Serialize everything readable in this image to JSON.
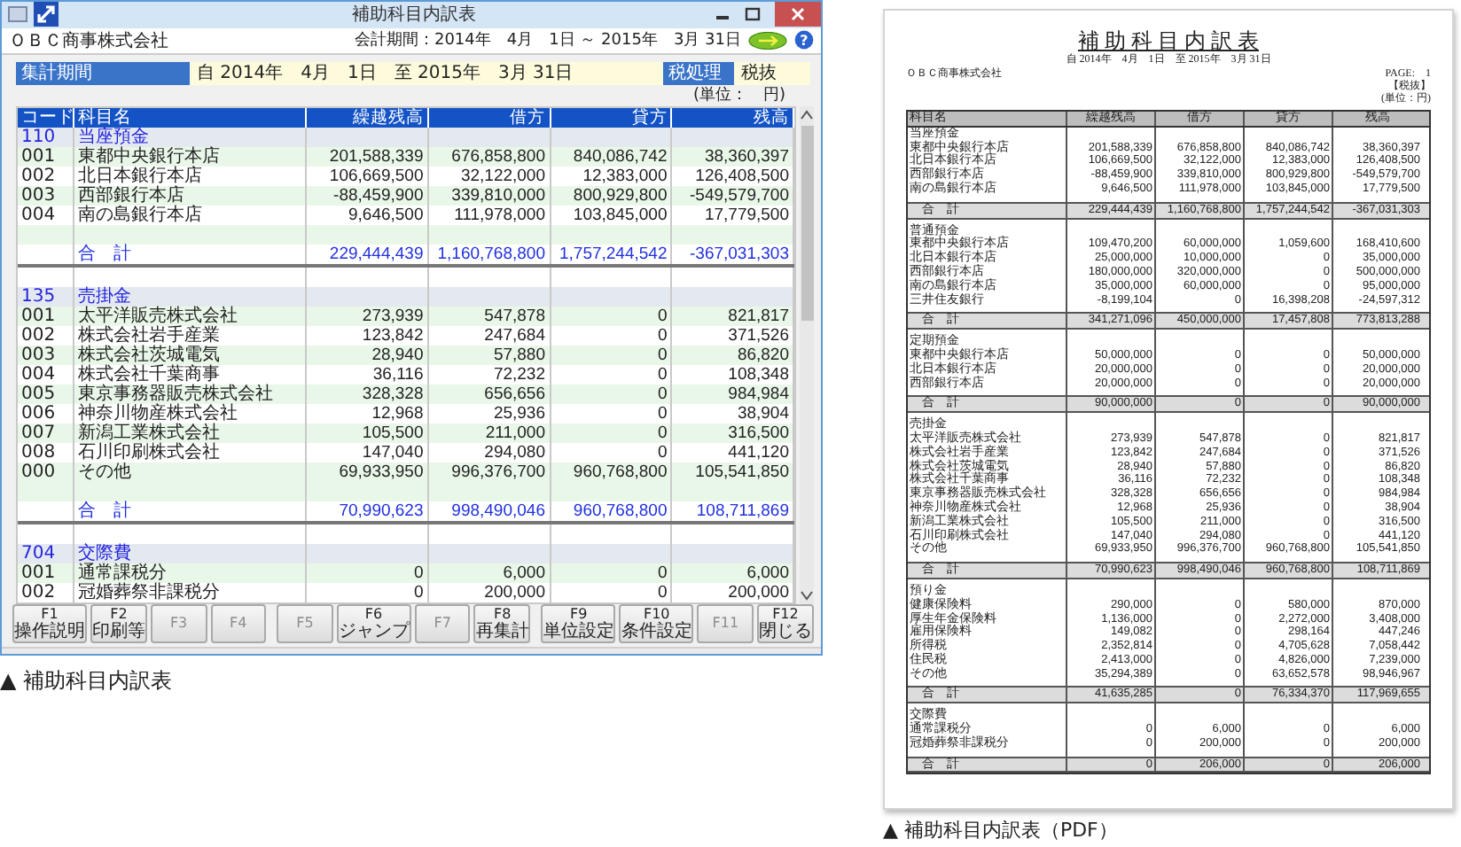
{
  "window": {
    "title": "補助科目内訳表",
    "company": "ＯＢＣ商事株式会社",
    "period": "会計期間：2014年　4月　1日 ～ 2015年　3月 31日",
    "help": "?"
  },
  "filter": {
    "period_label": "集計期間",
    "period_value": "自 2014年　4月　1日　至 2015年　3月 31日",
    "tax_label": "税処理",
    "tax_value": "税抜",
    "unit": "(単位：　円)"
  },
  "table": {
    "columns": [
      "コード",
      "科目名",
      "繰越残高",
      "借方",
      "貸方",
      "残高"
    ],
    "sections": [
      {
        "code": "110",
        "name": "当座預金",
        "rows": [
          {
            "code": "001",
            "name": "東都中央銀行本店",
            "values": [
              "201,588,339",
              "676,858,800",
              "840,086,742",
              "38,360,397"
            ]
          },
          {
            "code": "002",
            "name": "北日本銀行本店",
            "values": [
              "106,669,500",
              "32,122,000",
              "12,383,000",
              "126,408,500"
            ]
          },
          {
            "code": "003",
            "name": "西部銀行本店",
            "values": [
              "-88,459,900",
              "339,810,000",
              "800,929,800",
              "-549,579,700"
            ]
          },
          {
            "code": "004",
            "name": "南の島銀行本店",
            "values": [
              "9,646,500",
              "111,978,000",
              "103,845,000",
              "17,779,500"
            ]
          }
        ],
        "total": {
          "label": "合　計",
          "values": [
            "229,444,439",
            "1,160,768,800",
            "1,757,244,542",
            "-367,031,303"
          ]
        }
      },
      {
        "code": "135",
        "name": "売掛金",
        "rows": [
          {
            "code": "001",
            "name": "太平洋販売株式会社",
            "values": [
              "273,939",
              "547,878",
              "0",
              "821,817"
            ]
          },
          {
            "code": "002",
            "name": "株式会社岩手産業",
            "values": [
              "123,842",
              "247,684",
              "0",
              "371,526"
            ]
          },
          {
            "code": "003",
            "name": "株式会社茨城電気",
            "values": [
              "28,940",
              "57,880",
              "0",
              "86,820"
            ]
          },
          {
            "code": "004",
            "name": "株式会社千葉商事",
            "values": [
              "36,116",
              "72,232",
              "0",
              "108,348"
            ]
          },
          {
            "code": "005",
            "name": "東京事務器販売株式会社",
            "values": [
              "328,328",
              "656,656",
              "0",
              "984,984"
            ]
          },
          {
            "code": "006",
            "name": "神奈川物産株式会社",
            "values": [
              "12,968",
              "25,936",
              "0",
              "38,904"
            ]
          },
          {
            "code": "007",
            "name": "新潟工業株式会社",
            "values": [
              "105,500",
              "211,000",
              "0",
              "316,500"
            ]
          },
          {
            "code": "008",
            "name": "石川印刷株式会社",
            "values": [
              "147,040",
              "294,080",
              "0",
              "441,120"
            ]
          },
          {
            "code": "000",
            "name": "その他",
            "values": [
              "69,933,950",
              "996,376,700",
              "960,768,800",
              "105,541,850"
            ]
          }
        ],
        "total": {
          "label": "合　計",
          "values": [
            "70,990,623",
            "998,490,046",
            "960,768,800",
            "108,711,869"
          ]
        }
      },
      {
        "code": "704",
        "name": "交際費",
        "rows": [
          {
            "code": "001",
            "name": "通常課税分",
            "values": [
              "0",
              "6,000",
              "0",
              "6,000"
            ]
          },
          {
            "code": "002",
            "name": "冠婚葬祭非課税分",
            "values": [
              "0",
              "200,000",
              "0",
              "200,000"
            ]
          }
        ]
      }
    ]
  },
  "function_keys": [
    {
      "key": "F1",
      "label": "操作説明",
      "disabled": false
    },
    {
      "key": "F2",
      "label": "印刷等",
      "disabled": false
    },
    {
      "key": "F3",
      "disabled": true
    },
    {
      "key": "F4",
      "disabled": true
    },
    {
      "key": "F5",
      "disabled": true
    },
    {
      "key": "F6",
      "label": "ジャンプ",
      "disabled": false
    },
    {
      "key": "F7",
      "disabled": true
    },
    {
      "key": "F8",
      "label": "再集計",
      "disabled": false
    },
    {
      "key": "F9",
      "label": "単位設定",
      "disabled": false
    },
    {
      "key": "F10",
      "label": "条件設定",
      "disabled": false
    },
    {
      "key": "F11",
      "disabled": true
    },
    {
      "key": "F12",
      "label": "閉じる",
      "disabled": false
    }
  ],
  "caption": "▲ 補助科目内訳表",
  "pdf": {
    "title": "補 助 科 目 内 訳 表",
    "period": "自 2014年　4月　1日　至 2015年　3月 31日",
    "company": "ＯＢＣ商事株式会社",
    "page": "PAGE:　1",
    "tax": "【税抜】",
    "unit": "(単位：円)",
    "columns": [
      "科目名",
      "繰越残高",
      "借方",
      "貸方",
      "残高"
    ],
    "sections": [
      {
        "name": "当座預金",
        "rows": [
          {
            "name": "東都中央銀行本店",
            "values": [
              "201,588,339",
              "676,858,800",
              "840,086,742",
              "38,360,397"
            ]
          },
          {
            "name": "北日本銀行本店",
            "values": [
              "106,669,500",
              "32,122,000",
              "12,383,000",
              "126,408,500"
            ]
          },
          {
            "name": "西部銀行本店",
            "values": [
              "-88,459,900",
              "339,810,000",
              "800,929,800",
              "-549,579,700"
            ]
          },
          {
            "name": "南の島銀行本店",
            "values": [
              "9,646,500",
              "111,978,000",
              "103,845,000",
              "17,779,500"
            ]
          }
        ],
        "total": {
          "label": "合　計",
          "values": [
            "229,444,439",
            "1,160,768,800",
            "1,757,244,542",
            "-367,031,303"
          ]
        }
      },
      {
        "name": "普通預金",
        "rows": [
          {
            "name": "東都中央銀行本店",
            "values": [
              "109,470,200",
              "60,000,000",
              "1,059,600",
              "168,410,600"
            ]
          },
          {
            "name": "北日本銀行本店",
            "values": [
              "25,000,000",
              "10,000,000",
              "0",
              "35,000,000"
            ]
          },
          {
            "name": "西部銀行本店",
            "values": [
              "180,000,000",
              "320,000,000",
              "0",
              "500,000,000"
            ]
          },
          {
            "name": "南の島銀行本店",
            "values": [
              "35,000,000",
              "60,000,000",
              "0",
              "95,000,000"
            ]
          },
          {
            "name": "三井住友銀行",
            "values": [
              "-8,199,104",
              "0",
              "16,398,208",
              "-24,597,312"
            ]
          }
        ],
        "total": {
          "label": "合　計",
          "values": [
            "341,271,096",
            "450,000,000",
            "17,457,808",
            "773,813,288"
          ]
        }
      },
      {
        "name": "定期預金",
        "rows": [
          {
            "name": "東都中央銀行本店",
            "values": [
              "50,000,000",
              "0",
              "0",
              "50,000,000"
            ]
          },
          {
            "name": "北日本銀行本店",
            "values": [
              "20,000,000",
              "0",
              "0",
              "20,000,000"
            ]
          },
          {
            "name": "西部銀行本店",
            "values": [
              "20,000,000",
              "0",
              "0",
              "20,000,000"
            ]
          }
        ],
        "total": {
          "label": "合　計",
          "values": [
            "90,000,000",
            "0",
            "0",
            "90,000,000"
          ]
        }
      },
      {
        "name": "売掛金",
        "rows": [
          {
            "name": "太平洋販売株式会社",
            "values": [
              "273,939",
              "547,878",
              "0",
              "821,817"
            ]
          },
          {
            "name": "株式会社岩手産業",
            "values": [
              "123,842",
              "247,684",
              "0",
              "371,526"
            ]
          },
          {
            "name": "株式会社茨城電気",
            "values": [
              "28,940",
              "57,880",
              "0",
              "86,820"
            ]
          },
          {
            "name": "株式会社千葉商事",
            "values": [
              "36,116",
              "72,232",
              "0",
              "108,348"
            ]
          },
          {
            "name": "東京事務器販売株式会社",
            "values": [
              "328,328",
              "656,656",
              "0",
              "984,984"
            ]
          },
          {
            "name": "神奈川物産株式会社",
            "values": [
              "12,968",
              "25,936",
              "0",
              "38,904"
            ]
          },
          {
            "name": "新潟工業株式会社",
            "values": [
              "105,500",
              "211,000",
              "0",
              "316,500"
            ]
          },
          {
            "name": "石川印刷株式会社",
            "values": [
              "147,040",
              "294,080",
              "0",
              "441,120"
            ]
          },
          {
            "name": "その他",
            "values": [
              "69,933,950",
              "996,376,700",
              "960,768,800",
              "105,541,850"
            ]
          }
        ],
        "total": {
          "label": "合　計",
          "values": [
            "70,990,623",
            "998,490,046",
            "960,768,800",
            "108,711,869"
          ]
        }
      },
      {
        "name": "預り金",
        "rows": [
          {
            "name": "健康保険料",
            "values": [
              "290,000",
              "0",
              "580,000",
              "870,000"
            ]
          },
          {
            "name": "厚生年金保険料",
            "values": [
              "1,136,000",
              "0",
              "2,272,000",
              "3,408,000"
            ]
          },
          {
            "name": "雇用保険料",
            "values": [
              "149,082",
              "0",
              "298,164",
              "447,246"
            ]
          },
          {
            "name": "所得税",
            "values": [
              "2,352,814",
              "0",
              "4,705,628",
              "7,058,442"
            ]
          },
          {
            "name": "住民税",
            "values": [
              "2,413,000",
              "0",
              "4,826,000",
              "7,239,000"
            ]
          },
          {
            "name": "その他",
            "values": [
              "35,294,389",
              "0",
              "63,652,578",
              "98,946,967"
            ]
          }
        ],
        "total": {
          "label": "合　計",
          "values": [
            "41,635,285",
            "0",
            "76,334,370",
            "117,969,655"
          ]
        }
      },
      {
        "name": "交際費",
        "rows": [
          {
            "name": "通常課税分",
            "values": [
              "0",
              "6,000",
              "0",
              "6,000"
            ]
          },
          {
            "name": "冠婚葬祭非課税分",
            "values": [
              "0",
              "200,000",
              "0",
              "200,000"
            ]
          }
        ],
        "total": {
          "label": "合　計",
          "values": [
            "0",
            "206,000",
            "0",
            "206,000"
          ]
        }
      }
    ]
  },
  "pdf_caption": "▲ 補助科目内訳表（PDF）"
}
